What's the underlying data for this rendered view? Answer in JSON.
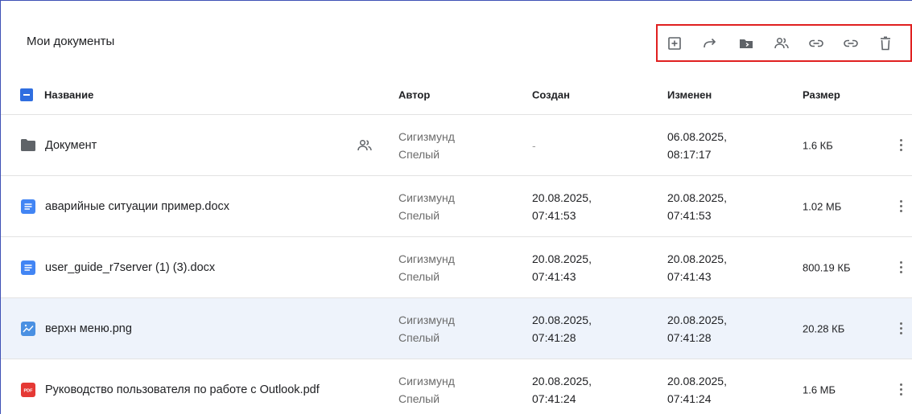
{
  "page_title": "Мои документы",
  "toolbar": {
    "buttons": [
      {
        "name": "create-button",
        "icon": "plus-box-icon"
      },
      {
        "name": "move-button",
        "icon": "forward-arrow-icon"
      },
      {
        "name": "move-to-folder-button",
        "icon": "folder-move-icon"
      },
      {
        "name": "share-button",
        "icon": "users-icon"
      },
      {
        "name": "copy-link-button",
        "icon": "link-icon"
      },
      {
        "name": "copy-link-2-button",
        "icon": "link-icon"
      },
      {
        "name": "delete-button",
        "icon": "trash-icon"
      }
    ],
    "highlight_color": "#e02020"
  },
  "columns": {
    "name": "Название",
    "author": "Автор",
    "created": "Создан",
    "modified": "Изменен",
    "size": "Размер"
  },
  "rows": [
    {
      "type": "folder",
      "icon": "folder-icon",
      "name": "Документ",
      "shared": true,
      "author1": "Сигизмунд",
      "author2": "Спелый",
      "created1": "-",
      "created2": "",
      "modified1": "06.08.2025,",
      "modified2": "08:17:17",
      "size": "1.6 КБ",
      "selected": false
    },
    {
      "type": "docx",
      "icon": "doc-icon",
      "name": "аварийные ситуации пример.docx",
      "shared": false,
      "author1": "Сигизмунд",
      "author2": "Спелый",
      "created1": "20.08.2025,",
      "created2": "07:41:53",
      "modified1": "20.08.2025,",
      "modified2": "07:41:53",
      "size": "1.02 МБ",
      "selected": false
    },
    {
      "type": "docx",
      "icon": "doc-icon",
      "name": "user_guide_r7server (1) (3).docx",
      "shared": false,
      "author1": "Сигизмунд",
      "author2": "Спелый",
      "created1": "20.08.2025,",
      "created2": "07:41:43",
      "modified1": "20.08.2025,",
      "modified2": "07:41:43",
      "size": "800.19 КБ",
      "selected": false
    },
    {
      "type": "image",
      "icon": "image-icon",
      "name": "верхн меню.png",
      "shared": false,
      "author1": "Сигизмунд",
      "author2": "Спелый",
      "created1": "20.08.2025,",
      "created2": "07:41:28",
      "modified1": "20.08.2025,",
      "modified2": "07:41:28",
      "size": "20.28 КБ",
      "selected": true
    },
    {
      "type": "pdf",
      "icon": "pdf-icon",
      "name": "Руководство пользователя по работе с Outlook.pdf",
      "shared": false,
      "author1": "Сигизмунд",
      "author2": "Спелый",
      "created1": "20.08.2025,",
      "created2": "07:41:24",
      "modified1": "20.08.2025,",
      "modified2": "07:41:24",
      "size": "1.6 МБ",
      "selected": false
    }
  ],
  "pdf_badge": "PDF",
  "colors": {
    "accent": "#2f6ee0",
    "folder": "#5f6368",
    "doc": "#4285f4",
    "image": "#4a90e2",
    "pdf": "#e53935",
    "selected_row": "#eef3fb"
  }
}
